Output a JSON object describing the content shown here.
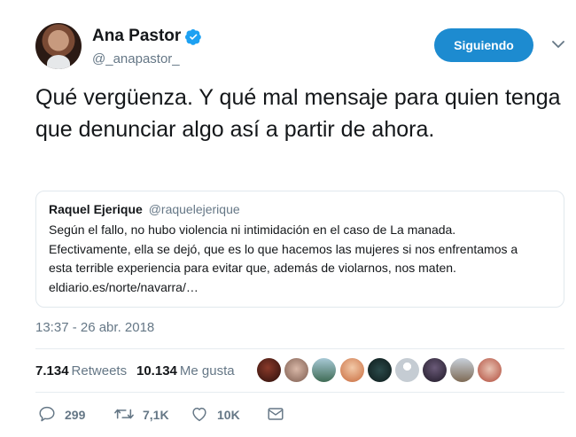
{
  "profile": {
    "display_name": "Ana Pastor",
    "handle": "@_anapastor_",
    "follow_label": "Siguiendo"
  },
  "tweet": {
    "text": "Qué vergüenza. Y qué mal mensaje para quien tenga que denunciar algo así a partir de ahora.",
    "timestamp": "13:37 - 26 abr. 2018"
  },
  "quote": {
    "name": "Raquel Ejerique",
    "handle": "@raquelejerique",
    "line1": "Según el fallo, no hubo violencia ni intimidación en el caso de La manada.",
    "line2": "Efectivamente, ella se dejó, que es lo que hacemos las mujeres si nos enfrentamos a",
    "line3": "esta terrible experiencia para evitar que, además de violarnos, nos maten.",
    "line4": "eldiario.es/norte/navarra/…"
  },
  "stats": {
    "retweets_count": "7.134",
    "retweets_label": "Retweets",
    "likes_count": "10.134",
    "likes_label": "Me gusta"
  },
  "actions": {
    "reply_count": "299",
    "retweet_count": "7,1K",
    "like_count": "10K"
  },
  "colors": {
    "accent": "#1d8bd0",
    "secondary_text": "#657786",
    "border": "#e1e8ed"
  },
  "icons": [
    "verified-icon",
    "chevron-down-icon",
    "reply-icon",
    "retweet-icon",
    "like-icon",
    "message-icon"
  ]
}
